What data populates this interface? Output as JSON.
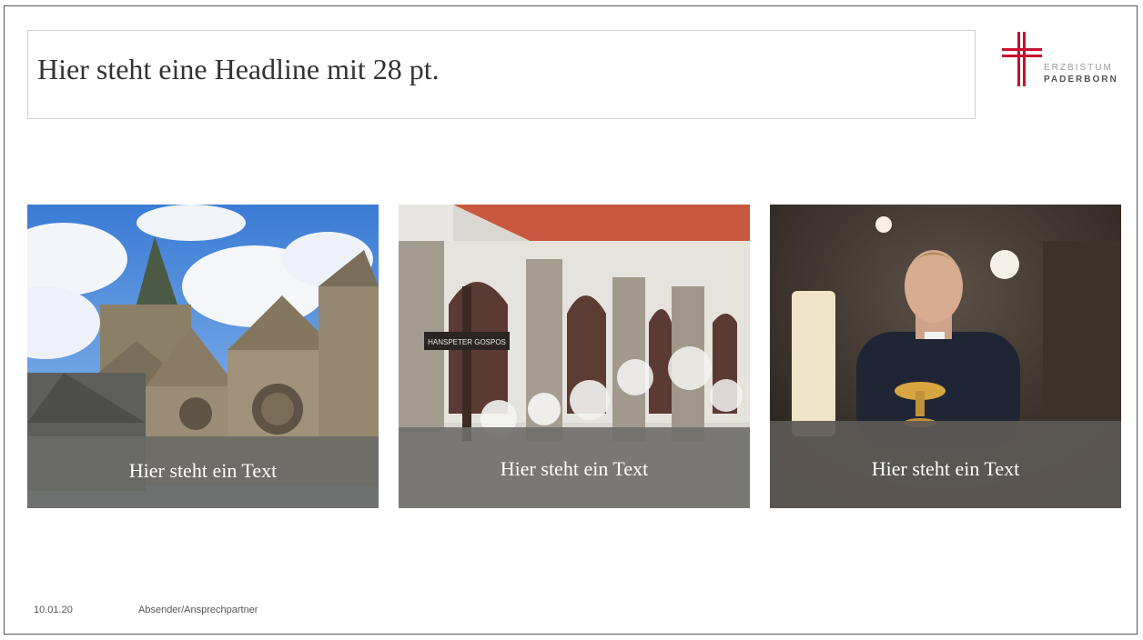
{
  "slide": {
    "headline": "Hier steht eine Headline mit 28 pt."
  },
  "logo": {
    "icon": "cross-icon",
    "line1": "ERZBISTUM",
    "line2": "PADERBORN",
    "accent_color": "#c8102e"
  },
  "cards": [
    {
      "caption": "Hier steht ein Text"
    },
    {
      "caption": "Hier steht ein Text",
      "sign_line1": "HANSPETER GOSPOS"
    },
    {
      "caption": "Hier steht ein Text"
    }
  ],
  "footer": {
    "date": "10.01.20",
    "sender": "Absender/Ansprechpartner"
  }
}
